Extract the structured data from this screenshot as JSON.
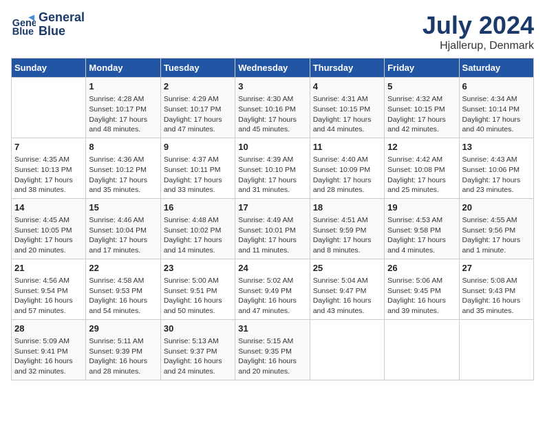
{
  "logo": {
    "line1": "General",
    "line2": "Blue"
  },
  "title": "July 2024",
  "subtitle": "Hjallerup, Denmark",
  "days_header": [
    "Sunday",
    "Monday",
    "Tuesday",
    "Wednesday",
    "Thursday",
    "Friday",
    "Saturday"
  ],
  "weeks": [
    [
      {
        "day": "",
        "info": ""
      },
      {
        "day": "1",
        "info": "Sunrise: 4:28 AM\nSunset: 10:17 PM\nDaylight: 17 hours\nand 48 minutes."
      },
      {
        "day": "2",
        "info": "Sunrise: 4:29 AM\nSunset: 10:17 PM\nDaylight: 17 hours\nand 47 minutes."
      },
      {
        "day": "3",
        "info": "Sunrise: 4:30 AM\nSunset: 10:16 PM\nDaylight: 17 hours\nand 45 minutes."
      },
      {
        "day": "4",
        "info": "Sunrise: 4:31 AM\nSunset: 10:15 PM\nDaylight: 17 hours\nand 44 minutes."
      },
      {
        "day": "5",
        "info": "Sunrise: 4:32 AM\nSunset: 10:15 PM\nDaylight: 17 hours\nand 42 minutes."
      },
      {
        "day": "6",
        "info": "Sunrise: 4:34 AM\nSunset: 10:14 PM\nDaylight: 17 hours\nand 40 minutes."
      }
    ],
    [
      {
        "day": "7",
        "info": "Sunrise: 4:35 AM\nSunset: 10:13 PM\nDaylight: 17 hours\nand 38 minutes."
      },
      {
        "day": "8",
        "info": "Sunrise: 4:36 AM\nSunset: 10:12 PM\nDaylight: 17 hours\nand 35 minutes."
      },
      {
        "day": "9",
        "info": "Sunrise: 4:37 AM\nSunset: 10:11 PM\nDaylight: 17 hours\nand 33 minutes."
      },
      {
        "day": "10",
        "info": "Sunrise: 4:39 AM\nSunset: 10:10 PM\nDaylight: 17 hours\nand 31 minutes."
      },
      {
        "day": "11",
        "info": "Sunrise: 4:40 AM\nSunset: 10:09 PM\nDaylight: 17 hours\nand 28 minutes."
      },
      {
        "day": "12",
        "info": "Sunrise: 4:42 AM\nSunset: 10:08 PM\nDaylight: 17 hours\nand 25 minutes."
      },
      {
        "day": "13",
        "info": "Sunrise: 4:43 AM\nSunset: 10:06 PM\nDaylight: 17 hours\nand 23 minutes."
      }
    ],
    [
      {
        "day": "14",
        "info": "Sunrise: 4:45 AM\nSunset: 10:05 PM\nDaylight: 17 hours\nand 20 minutes."
      },
      {
        "day": "15",
        "info": "Sunrise: 4:46 AM\nSunset: 10:04 PM\nDaylight: 17 hours\nand 17 minutes."
      },
      {
        "day": "16",
        "info": "Sunrise: 4:48 AM\nSunset: 10:02 PM\nDaylight: 17 hours\nand 14 minutes."
      },
      {
        "day": "17",
        "info": "Sunrise: 4:49 AM\nSunset: 10:01 PM\nDaylight: 17 hours\nand 11 minutes."
      },
      {
        "day": "18",
        "info": "Sunrise: 4:51 AM\nSunset: 9:59 PM\nDaylight: 17 hours\nand 8 minutes."
      },
      {
        "day": "19",
        "info": "Sunrise: 4:53 AM\nSunset: 9:58 PM\nDaylight: 17 hours\nand 4 minutes."
      },
      {
        "day": "20",
        "info": "Sunrise: 4:55 AM\nSunset: 9:56 PM\nDaylight: 17 hours\nand 1 minute."
      }
    ],
    [
      {
        "day": "21",
        "info": "Sunrise: 4:56 AM\nSunset: 9:54 PM\nDaylight: 16 hours\nand 57 minutes."
      },
      {
        "day": "22",
        "info": "Sunrise: 4:58 AM\nSunset: 9:53 PM\nDaylight: 16 hours\nand 54 minutes."
      },
      {
        "day": "23",
        "info": "Sunrise: 5:00 AM\nSunset: 9:51 PM\nDaylight: 16 hours\nand 50 minutes."
      },
      {
        "day": "24",
        "info": "Sunrise: 5:02 AM\nSunset: 9:49 PM\nDaylight: 16 hours\nand 47 minutes."
      },
      {
        "day": "25",
        "info": "Sunrise: 5:04 AM\nSunset: 9:47 PM\nDaylight: 16 hours\nand 43 minutes."
      },
      {
        "day": "26",
        "info": "Sunrise: 5:06 AM\nSunset: 9:45 PM\nDaylight: 16 hours\nand 39 minutes."
      },
      {
        "day": "27",
        "info": "Sunrise: 5:08 AM\nSunset: 9:43 PM\nDaylight: 16 hours\nand 35 minutes."
      }
    ],
    [
      {
        "day": "28",
        "info": "Sunrise: 5:09 AM\nSunset: 9:41 PM\nDaylight: 16 hours\nand 32 minutes."
      },
      {
        "day": "29",
        "info": "Sunrise: 5:11 AM\nSunset: 9:39 PM\nDaylight: 16 hours\nand 28 minutes."
      },
      {
        "day": "30",
        "info": "Sunrise: 5:13 AM\nSunset: 9:37 PM\nDaylight: 16 hours\nand 24 minutes."
      },
      {
        "day": "31",
        "info": "Sunrise: 5:15 AM\nSunset: 9:35 PM\nDaylight: 16 hours\nand 20 minutes."
      },
      {
        "day": "",
        "info": ""
      },
      {
        "day": "",
        "info": ""
      },
      {
        "day": "",
        "info": ""
      }
    ]
  ]
}
